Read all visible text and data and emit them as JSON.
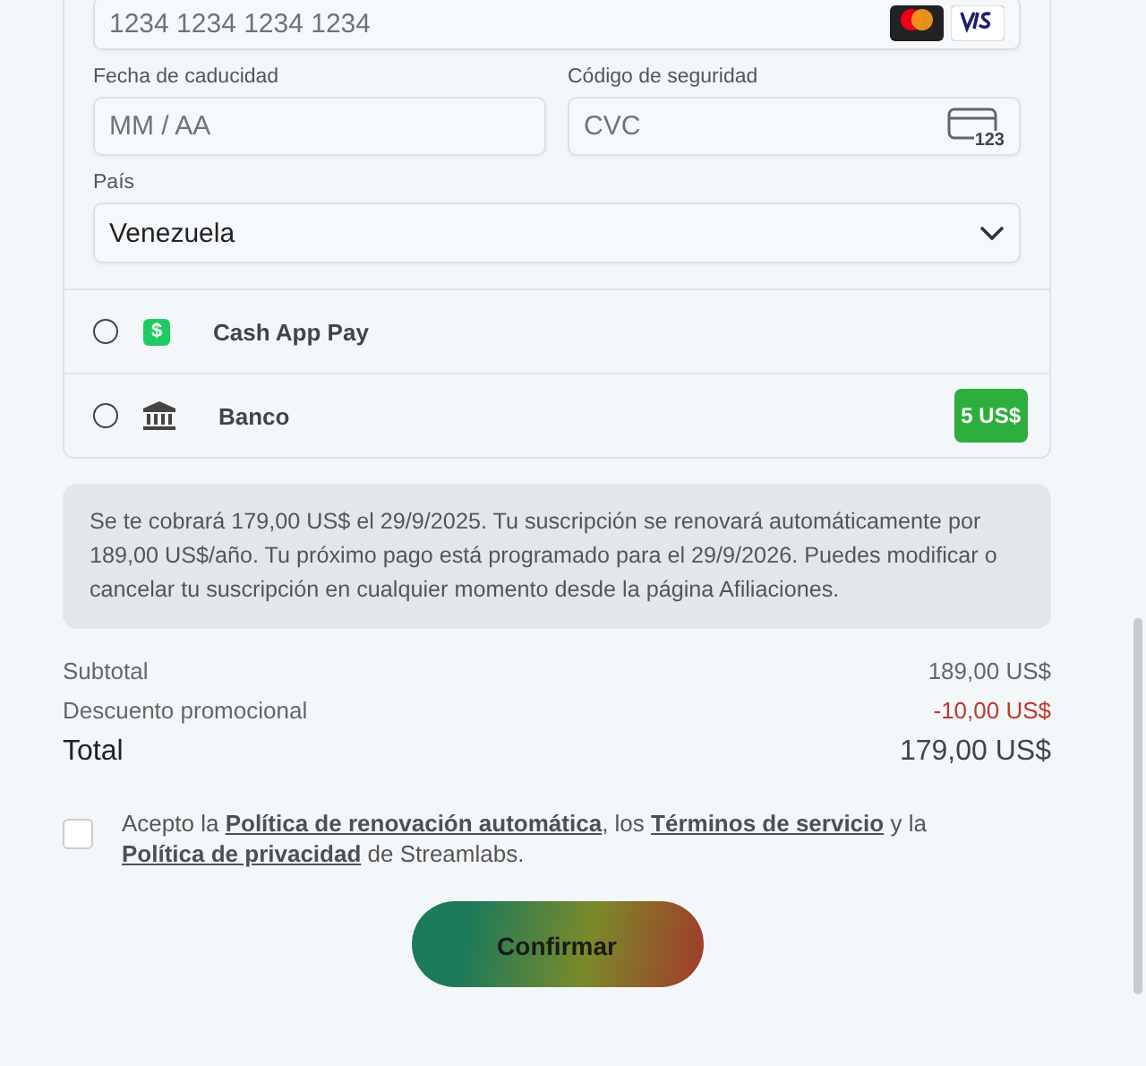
{
  "card_number": {
    "placeholder": "1234 1234 1234 1234"
  },
  "expiry": {
    "label": "Fecha de caducidad",
    "placeholder": "MM / AA"
  },
  "cvc": {
    "label": "Código de seguridad",
    "placeholder": "CVC",
    "icon_text": "123"
  },
  "country": {
    "label": "País",
    "value": "Venezuela"
  },
  "payment_methods": [
    {
      "kind": "cashapp",
      "label": "Cash App Pay",
      "selected": false,
      "icon_text": "$"
    },
    {
      "kind": "bank",
      "label": "Banco",
      "selected": false,
      "badge": "5 US$"
    }
  ],
  "notice": "Se te cobrará 179,00 US$ el 29/9/2025. Tu suscripción se renovará automáticamente por 189,00 US$/año. Tu próximo pago está programado para el 29/9/2026. Puedes modificar o cancelar tu suscripción en cualquier momento desde la página Afiliaciones.",
  "summary": [
    {
      "kind": "normal",
      "label": "Subtotal",
      "value": "189,00 US$"
    },
    {
      "kind": "discount",
      "label": "Descuento promocional",
      "value": "-10,00 US$"
    },
    {
      "kind": "total",
      "label": "Total",
      "value": "179,00 US$"
    }
  ],
  "consent": {
    "checked": false,
    "parts": [
      {
        "kind": "text",
        "text": "Acepto la "
      },
      {
        "kind": "link",
        "text": "Política de renovación automática"
      },
      {
        "kind": "text",
        "text": ", los "
      },
      {
        "kind": "link",
        "text": "Términos de servicio"
      },
      {
        "kind": "text",
        "text": " y la "
      },
      {
        "kind": "link",
        "text": "Política de privacidad"
      },
      {
        "kind": "text",
        "text": " de Streamlabs."
      }
    ]
  },
  "confirm_button": "Confirmar"
}
